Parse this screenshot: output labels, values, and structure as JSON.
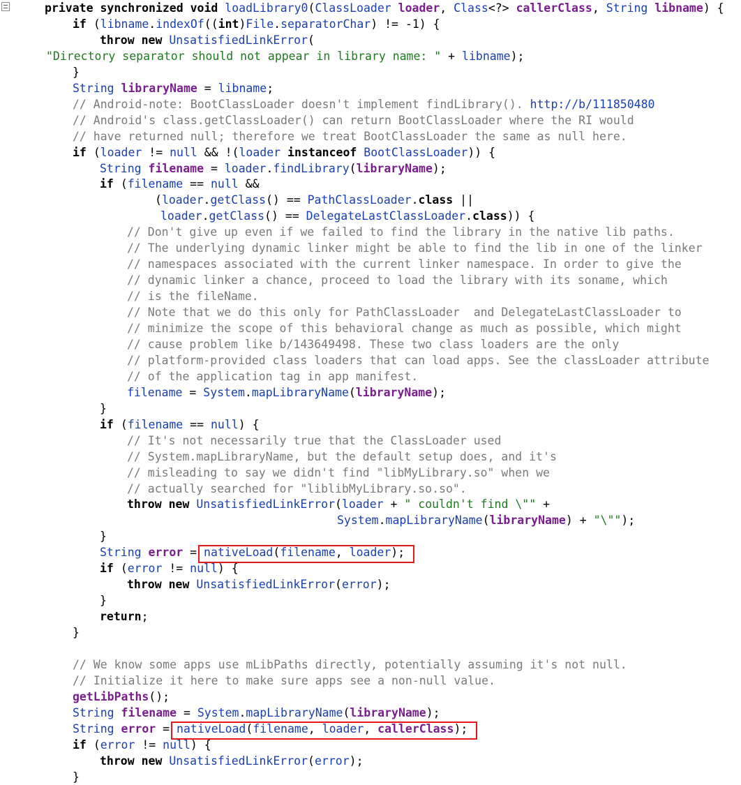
{
  "code_lines": [
    {
      "indent": 64,
      "tokens": [
        [
          "kw",
          "private synchronized void "
        ],
        [
          "id",
          "loadLibrary0"
        ],
        [
          "op",
          "("
        ],
        [
          "ty",
          "ClassLoader "
        ],
        [
          "var",
          "loader"
        ],
        [
          "op",
          ", "
        ],
        [
          "ty",
          "Class"
        ],
        [
          "op",
          "<?> "
        ],
        [
          "var",
          "callerClass"
        ],
        [
          "op",
          ", "
        ],
        [
          "ty",
          "String "
        ],
        [
          "var",
          "libname"
        ],
        [
          "op",
          ") {"
        ]
      ]
    },
    {
      "indent": 104,
      "tokens": [
        [
          "kw",
          "if "
        ],
        [
          "op",
          "("
        ],
        [
          "id",
          "libname"
        ],
        [
          "op",
          "."
        ],
        [
          "id",
          "indexOf"
        ],
        [
          "op",
          "(("
        ],
        [
          "kw",
          "int"
        ],
        [
          "op",
          ")"
        ],
        [
          "id",
          "File"
        ],
        [
          "op",
          "."
        ],
        [
          "id",
          "separatorChar"
        ],
        [
          "op",
          ") != -1) {"
        ]
      ]
    },
    {
      "indent": 143,
      "tokens": [
        [
          "kw",
          "throw new "
        ],
        [
          "ty",
          "UnsatisfiedLinkError"
        ],
        [
          "op",
          "("
        ]
      ]
    },
    {
      "indent": 66,
      "tokens": [
        [
          "str",
          "\"Directory separator should not appear in library name: \""
        ],
        [
          "op",
          " + "
        ],
        [
          "id",
          "libname"
        ],
        [
          "op",
          ");"
        ]
      ]
    },
    {
      "indent": 104,
      "tokens": [
        [
          "op",
          "}"
        ]
      ]
    },
    {
      "indent": 104,
      "tokens": [
        [
          "ty",
          "String "
        ],
        [
          "var",
          "libraryName"
        ],
        [
          "op",
          " = "
        ],
        [
          "id",
          "libname"
        ],
        [
          "op",
          ";"
        ]
      ]
    },
    {
      "indent": 104,
      "tokens": [
        [
          "cm",
          "// Android-note: BootClassLoader doesn't implement findLibrary(). "
        ],
        [
          "cmurl",
          "http://b/111850480"
        ]
      ]
    },
    {
      "indent": 104,
      "tokens": [
        [
          "cm",
          "// Android's class.getClassLoader() can return BootClassLoader where the RI would"
        ]
      ]
    },
    {
      "indent": 104,
      "tokens": [
        [
          "cm",
          "// have returned null; therefore we treat BootClassLoader the same as null here."
        ]
      ]
    },
    {
      "indent": 104,
      "tokens": [
        [
          "kw",
          "if "
        ],
        [
          "op",
          "("
        ],
        [
          "id",
          "loader"
        ],
        [
          "op",
          " != "
        ],
        [
          "id",
          "null"
        ],
        [
          "op",
          " && !("
        ],
        [
          "id",
          "loader "
        ],
        [
          "kw",
          "instanceof "
        ],
        [
          "ty",
          "BootClassLoader"
        ],
        [
          "op",
          ")) {"
        ]
      ]
    },
    {
      "indent": 143,
      "tokens": [
        [
          "ty",
          "String "
        ],
        [
          "var",
          "filename"
        ],
        [
          "op",
          " = "
        ],
        [
          "id",
          "loader"
        ],
        [
          "op",
          "."
        ],
        [
          "id",
          "findLibrary"
        ],
        [
          "op",
          "("
        ],
        [
          "var",
          "libraryName"
        ],
        [
          "op",
          ");"
        ]
      ]
    },
    {
      "indent": 143,
      "tokens": [
        [
          "kw",
          "if "
        ],
        [
          "op",
          "("
        ],
        [
          "id",
          "filename"
        ],
        [
          "op",
          " == "
        ],
        [
          "id",
          "null"
        ],
        [
          "op",
          " &&"
        ]
      ]
    },
    {
      "indent": 222,
      "tokens": [
        [
          "op",
          "("
        ],
        [
          "id",
          "loader"
        ],
        [
          "op",
          "."
        ],
        [
          "id",
          "getClass"
        ],
        [
          "op",
          "() == "
        ],
        [
          "ty",
          "PathClassLoader"
        ],
        [
          "op",
          "."
        ],
        [
          "kw",
          "class"
        ],
        [
          "op",
          " ||"
        ]
      ]
    },
    {
      "indent": 230,
      "tokens": [
        [
          "id",
          "loader"
        ],
        [
          "op",
          "."
        ],
        [
          "id",
          "getClass"
        ],
        [
          "op",
          "() == "
        ],
        [
          "ty",
          "DelegateLastClassLoader"
        ],
        [
          "op",
          "."
        ],
        [
          "kw",
          "class"
        ],
        [
          "op",
          ")) {"
        ]
      ]
    },
    {
      "indent": 182,
      "tokens": [
        [
          "cm",
          "// Don't give up even if we failed to find the library in the native lib paths."
        ]
      ]
    },
    {
      "indent": 182,
      "tokens": [
        [
          "cm",
          "// The underlying dynamic linker might be able to find the lib in one of the linker"
        ]
      ]
    },
    {
      "indent": 182,
      "tokens": [
        [
          "cm",
          "// namespaces associated with the current linker namespace. In order to give the"
        ]
      ]
    },
    {
      "indent": 182,
      "tokens": [
        [
          "cm",
          "// dynamic linker a chance, proceed to load the library with its soname, which"
        ]
      ]
    },
    {
      "indent": 182,
      "tokens": [
        [
          "cm",
          "// is the fileName."
        ]
      ]
    },
    {
      "indent": 182,
      "tokens": [
        [
          "cm",
          "// Note that we do this only for PathClassLoader  and DelegateLastClassLoader to"
        ]
      ]
    },
    {
      "indent": 182,
      "tokens": [
        [
          "cm",
          "// minimize the scope of this behavioral change as much as possible, which might"
        ]
      ]
    },
    {
      "indent": 182,
      "tokens": [
        [
          "cm",
          "// cause problem like b/143649498. These two class loaders are the only"
        ]
      ]
    },
    {
      "indent": 182,
      "tokens": [
        [
          "cm",
          "// platform-provided class loaders that can load apps. See the classLoader attribute"
        ]
      ]
    },
    {
      "indent": 182,
      "tokens": [
        [
          "cm",
          "// of the application tag in app manifest."
        ]
      ]
    },
    {
      "indent": 182,
      "tokens": [
        [
          "id",
          "filename"
        ],
        [
          "op",
          " = "
        ],
        [
          "id",
          "System"
        ],
        [
          "op",
          "."
        ],
        [
          "id",
          "mapLibraryName"
        ],
        [
          "op",
          "("
        ],
        [
          "var",
          "libraryName"
        ],
        [
          "op",
          ");"
        ]
      ]
    },
    {
      "indent": 143,
      "tokens": [
        [
          "op",
          "}"
        ]
      ]
    },
    {
      "indent": 143,
      "tokens": [
        [
          "kw",
          "if "
        ],
        [
          "op",
          "("
        ],
        [
          "id",
          "filename"
        ],
        [
          "op",
          " == "
        ],
        [
          "id",
          "null"
        ],
        [
          "op",
          ") {"
        ]
      ]
    },
    {
      "indent": 182,
      "tokens": [
        [
          "cm",
          "// It's not necessarily true that the ClassLoader used"
        ]
      ]
    },
    {
      "indent": 182,
      "tokens": [
        [
          "cm",
          "// System.mapLibraryName, but the default setup does, and it's"
        ]
      ]
    },
    {
      "indent": 182,
      "tokens": [
        [
          "cm",
          "// misleading to say we didn't find \"libMyLibrary.so\" when we"
        ]
      ]
    },
    {
      "indent": 182,
      "tokens": [
        [
          "cm",
          "// actually searched for \"liblibMyLibrary.so.so\"."
        ]
      ]
    },
    {
      "indent": 182,
      "tokens": [
        [
          "kw",
          "throw new "
        ],
        [
          "ty",
          "UnsatisfiedLinkError"
        ],
        [
          "op",
          "("
        ],
        [
          "id",
          "loader"
        ],
        [
          "op",
          " + "
        ],
        [
          "str",
          "\" couldn't find \\\"\""
        ],
        [
          "op",
          " +"
        ]
      ]
    },
    {
      "indent": 483,
      "tokens": [
        [
          "id",
          "System"
        ],
        [
          "op",
          "."
        ],
        [
          "id",
          "mapLibraryName"
        ],
        [
          "op",
          "("
        ],
        [
          "var",
          "libraryName"
        ],
        [
          "op",
          ") + "
        ],
        [
          "str",
          "\"\\\"\""
        ],
        [
          "op",
          ");"
        ]
      ]
    },
    {
      "indent": 143,
      "tokens": [
        [
          "op",
          "}"
        ]
      ]
    },
    {
      "indent": 143,
      "tokens": [
        [
          "ty",
          "String "
        ],
        [
          "var",
          "error"
        ],
        [
          "op",
          " = "
        ],
        [
          "id",
          "nativeLoad"
        ],
        [
          "op",
          "("
        ],
        [
          "id",
          "filename"
        ],
        [
          "op",
          ", "
        ],
        [
          "id",
          "loader"
        ],
        [
          "op",
          ");"
        ]
      ]
    },
    {
      "indent": 143,
      "tokens": [
        [
          "kw",
          "if "
        ],
        [
          "op",
          "("
        ],
        [
          "id",
          "error"
        ],
        [
          "op",
          " != "
        ],
        [
          "id",
          "null"
        ],
        [
          "op",
          ") {"
        ]
      ]
    },
    {
      "indent": 182,
      "tokens": [
        [
          "kw",
          "throw new "
        ],
        [
          "ty",
          "UnsatisfiedLinkError"
        ],
        [
          "op",
          "("
        ],
        [
          "id",
          "error"
        ],
        [
          "op",
          ");"
        ]
      ]
    },
    {
      "indent": 143,
      "tokens": [
        [
          "op",
          "}"
        ]
      ]
    },
    {
      "indent": 143,
      "tokens": [
        [
          "kw",
          "return"
        ],
        [
          "op",
          ";"
        ]
      ]
    },
    {
      "indent": 104,
      "tokens": [
        [
          "op",
          "}"
        ]
      ]
    },
    {
      "indent": 104,
      "tokens": []
    },
    {
      "indent": 104,
      "tokens": [
        [
          "cm",
          "// We know some apps use mLibPaths directly, potentially assuming it's not null."
        ]
      ]
    },
    {
      "indent": 104,
      "tokens": [
        [
          "cm",
          "// Initialize it here to make sure apps see a non-null value."
        ]
      ]
    },
    {
      "indent": 104,
      "tokens": [
        [
          "var",
          "getLibPaths"
        ],
        [
          "op",
          "();"
        ]
      ]
    },
    {
      "indent": 104,
      "tokens": [
        [
          "ty",
          "String "
        ],
        [
          "var",
          "filename"
        ],
        [
          "op",
          " = "
        ],
        [
          "id",
          "System"
        ],
        [
          "op",
          "."
        ],
        [
          "id",
          "mapLibraryName"
        ],
        [
          "op",
          "("
        ],
        [
          "var",
          "libraryName"
        ],
        [
          "op",
          ");"
        ]
      ]
    },
    {
      "indent": 104,
      "tokens": [
        [
          "ty",
          "String "
        ],
        [
          "var",
          "error"
        ],
        [
          "op",
          " = "
        ],
        [
          "id",
          "nativeLoad"
        ],
        [
          "op",
          "("
        ],
        [
          "id",
          "filename"
        ],
        [
          "op",
          ", "
        ],
        [
          "id",
          "loader"
        ],
        [
          "op",
          ", "
        ],
        [
          "var",
          "callerClass"
        ],
        [
          "op",
          ");"
        ]
      ]
    },
    {
      "indent": 104,
      "tokens": [
        [
          "kw",
          "if "
        ],
        [
          "op",
          "("
        ],
        [
          "id",
          "error"
        ],
        [
          "op",
          " != "
        ],
        [
          "id",
          "null"
        ],
        [
          "op",
          ") {"
        ]
      ]
    },
    {
      "indent": 143,
      "tokens": [
        [
          "kw",
          "throw new "
        ],
        [
          "ty",
          "UnsatisfiedLinkError"
        ],
        [
          "op",
          "("
        ],
        [
          "id",
          "error"
        ],
        [
          "op",
          ");"
        ]
      ]
    },
    {
      "indent": 104,
      "tokens": [
        [
          "op",
          "}"
        ]
      ]
    }
  ],
  "highlights": [
    {
      "line": 34,
      "label": "nativeLoad-call-highlight-1"
    },
    {
      "line": 45,
      "label": "nativeLoad-call-highlight-2"
    }
  ],
  "colors": {
    "keyword": "#000000",
    "variable": "#7a1e8e",
    "type": "#1a3fb0",
    "string": "#1f7a1f",
    "comment": "#7a7a7a",
    "highlight_border": "#e8171b"
  }
}
